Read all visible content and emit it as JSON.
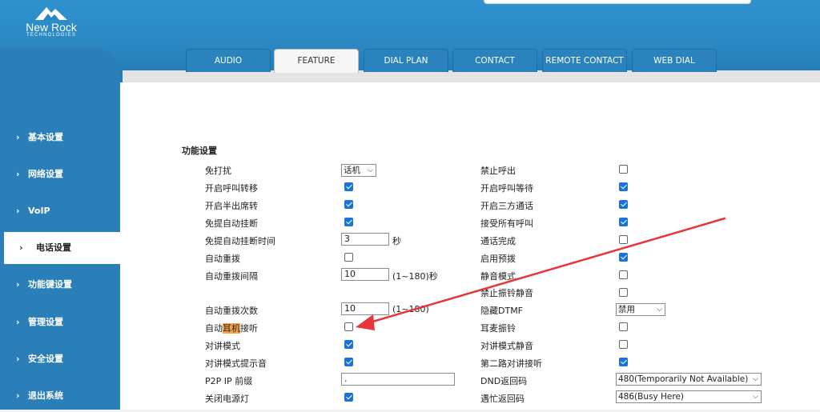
{
  "brand": {
    "name": "New Rock",
    "sub": "TECHNOLOGIES"
  },
  "sidebar": {
    "items": [
      {
        "label": "基本设置",
        "icon": "chevron-right-icon"
      },
      {
        "label": "网络设置",
        "icon": "chevron-right-icon"
      },
      {
        "label": "VoIP",
        "icon": "chevron-right-icon"
      },
      {
        "label": "电话设置",
        "icon": "chevron-right-icon",
        "active": true
      },
      {
        "label": "功能键设置",
        "icon": "chevron-right-icon"
      },
      {
        "label": "管理设置",
        "icon": "chevron-right-icon"
      },
      {
        "label": "安全设置",
        "icon": "chevron-right-icon"
      },
      {
        "label": "退出系统",
        "icon": "chevron-right-icon"
      }
    ]
  },
  "tabs": [
    "AUDIO",
    "FEATURE",
    "DIAL PLAN",
    "CONTACT",
    "REMOTE CONTACT",
    "WEB DIAL"
  ],
  "active_tab": "FEATURE",
  "section": {
    "title": "功能设置"
  },
  "left": {
    "dnd": {
      "label": "免打扰",
      "value": "话机"
    },
    "call_forward": {
      "label": "开启呼叫转移",
      "checked": true
    },
    "semi_attended": {
      "label": "开启半出席转",
      "checked": true
    },
    "handsfree_auto_hangup": {
      "label": "免提自动挂断",
      "checked": true
    },
    "handsfree_hangup_time": {
      "label": "免提自动挂断时间",
      "value": "3",
      "unit": "秒"
    },
    "auto_redial": {
      "label": "自动重拨",
      "checked": false
    },
    "redial_interval": {
      "label": "自动重拨间隔",
      "value": "10",
      "unit": "(1~180)秒"
    },
    "redial_times": {
      "label": "自动重拨次数",
      "value": "10",
      "unit": "(1~180)"
    },
    "headset_answer": {
      "label_pre": "自动",
      "label_hl": "耳机",
      "label_post": "接听",
      "checked": false
    },
    "intercom": {
      "label": "对讲模式",
      "checked": true
    },
    "intercom_tone": {
      "label": "对讲模式提示音",
      "checked": true
    },
    "p2p_prefix": {
      "label": "P2P IP 前缀",
      "value": "."
    },
    "power_led_off": {
      "label": "关闭电源灯",
      "checked": true
    }
  },
  "right": {
    "call_barring": {
      "label": "禁止呼出",
      "checked": false
    },
    "call_waiting": {
      "label": "开启呼叫等待",
      "checked": true
    },
    "three_way": {
      "label": "开启三方通话",
      "checked": true
    },
    "accept_all": {
      "label": "接受所有呼叫",
      "checked": true
    },
    "call_complete": {
      "label": "通话完成",
      "checked": false
    },
    "predial": {
      "label": "启用预拨",
      "checked": true
    },
    "silent_mode": {
      "label": "静音模式",
      "checked": false
    },
    "ring_mute": {
      "label": "禁止振铃静音",
      "checked": false
    },
    "hide_dtmf": {
      "label": "隐藏DTMF",
      "value": "禁用"
    },
    "headset_ring": {
      "label": "耳麦振铃",
      "checked": false
    },
    "intercom_mute": {
      "label": "对讲模式静音",
      "checked": false
    },
    "second_intercom": {
      "label": "第二路对讲接听",
      "checked": true
    },
    "dnd_code": {
      "label": "DND返回码",
      "value": "480(Temporarily Not Available)"
    },
    "busy_code": {
      "label": "遇忙返回码",
      "value": "486(Busy Here)"
    }
  },
  "colors": {
    "header": "#2a86c1",
    "sidebar": "#2a7fb8",
    "checkbox": "#1a73d8",
    "arrow": "#e8353a",
    "highlight": "#f7a44a"
  }
}
